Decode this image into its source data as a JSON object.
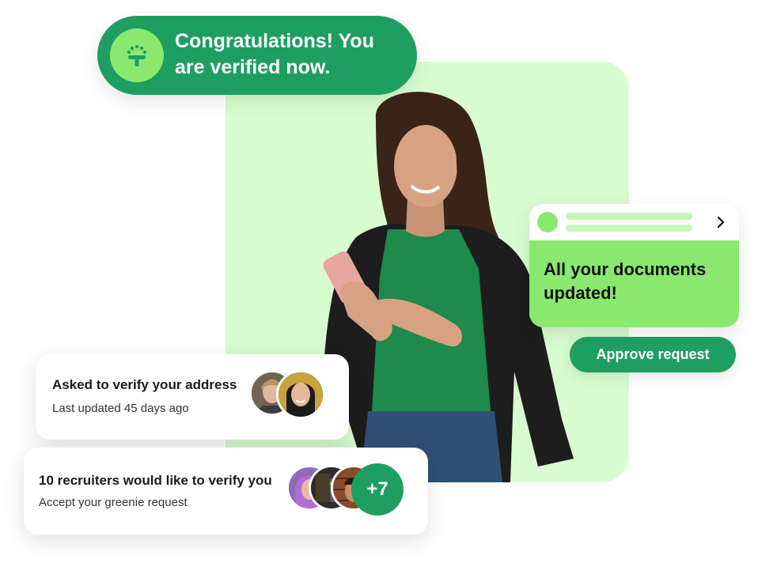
{
  "congrats": {
    "message_line1": "Congratulations! You",
    "message_line2": "are verified now."
  },
  "documents_card": {
    "title_line1": "All your documents",
    "title_line2": "updated!",
    "approve_label": "Approve request"
  },
  "address_card": {
    "title": "Asked to verify your address",
    "subtitle": "Last updated 45 days ago"
  },
  "recruiters_card": {
    "title": "10 recruiters would like to verify you",
    "subtitle": "Accept your greenie request",
    "more_count": "+7"
  },
  "colors": {
    "brand_green": "#1f9e62",
    "accent_green": "#8ae86f",
    "backdrop_green": "#d8fcd0"
  }
}
